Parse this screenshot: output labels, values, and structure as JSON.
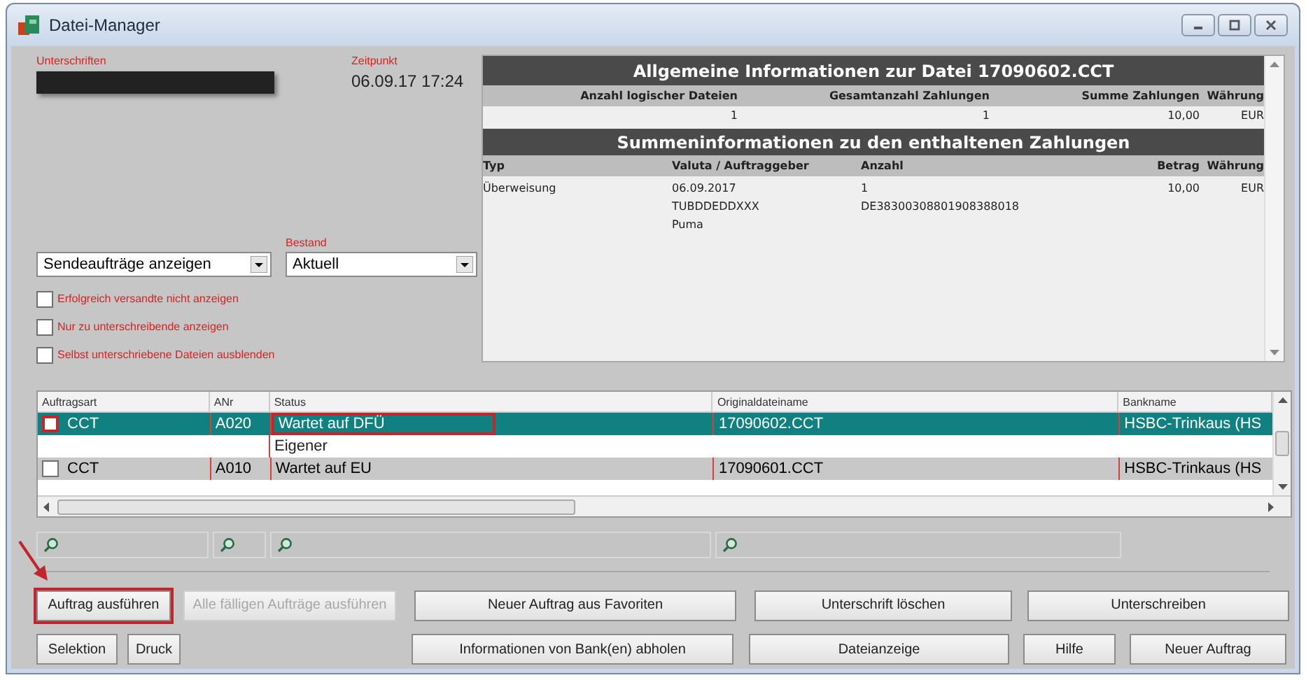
{
  "window": {
    "title": "Datei-Manager"
  },
  "signatures": {
    "label": "Unterschriften"
  },
  "timestamp": {
    "label": "Zeitpunkt",
    "value": "06.09.17 17:24"
  },
  "view_select": {
    "value": "Sendeaufträge anzeigen"
  },
  "stock_select": {
    "label": "Bestand",
    "value": "Aktuell"
  },
  "filters": [
    {
      "label": "Erfolgreich versandte nicht anzeigen",
      "checked": false
    },
    {
      "label": "Nur zu unterschreibende anzeigen",
      "checked": false
    },
    {
      "label": "Selbst unterschriebene Dateien ausblenden",
      "checked": false
    }
  ],
  "info": {
    "general_title": "Allgemeine Informationen zur Datei 17090602.CCT",
    "general_columns": [
      "Anzahl logischer Dateien",
      "Gesamtanzahl Zahlungen",
      "Summe Zahlungen",
      "Währung"
    ],
    "general_values": [
      "1",
      "1",
      "10,00",
      "EUR"
    ],
    "summary_title": "Summeninformationen zu den enthaltenen Zahlungen",
    "summary_columns": [
      "Typ",
      "Valuta / Auftraggeber",
      "Anzahl",
      "Betrag",
      "Währung"
    ],
    "summary_rows": [
      {
        "type": "Überweisung",
        "valuta": [
          "06.09.2017",
          "TUBDDEDDXXX",
          "Puma"
        ],
        "count": [
          "1",
          "DE38300308801908388018"
        ],
        "amount": "10,00",
        "currency": "EUR"
      }
    ]
  },
  "table": {
    "columns": [
      "Auftragsart",
      "ANr",
      "Status",
      "Originaldateiname",
      "Bankname"
    ],
    "rows": [
      {
        "checked": false,
        "selected": true,
        "highlighted": true,
        "cells": [
          "CCT",
          "A020",
          "Wartet auf DFÜ",
          "17090602.CCT",
          "HSBC-Trinkaus (HS"
        ],
        "note": "Eigener"
      },
      {
        "checked": false,
        "selected": false,
        "highlighted": false,
        "cells": [
          "CCT",
          "A010",
          "Wartet auf EU",
          "17090601.CCT",
          "HSBC-Trinkaus (HS"
        ]
      }
    ]
  },
  "button_rows": [
    [
      {
        "label": "Auftrag ausführen",
        "disabled": false,
        "highlighted": true
      },
      {
        "label": "Alle fälligen Aufträge ausführen",
        "disabled": true,
        "highlighted": false
      },
      {
        "label": "Neuer Auftrag aus Favoriten",
        "disabled": false,
        "highlighted": false
      },
      {
        "label": "Unterschrift löschen",
        "disabled": false,
        "highlighted": false
      },
      {
        "label": "Unterschreiben",
        "disabled": false,
        "highlighted": false
      }
    ],
    [
      {
        "label": "Selektion",
        "disabled": false,
        "highlighted": false
      },
      {
        "label": "Druck",
        "disabled": false,
        "highlighted": false
      },
      {
        "label": "Informationen von Bank(en) abholen",
        "disabled": false,
        "highlighted": false
      },
      {
        "label": "Dateianzeige",
        "disabled": false,
        "highlighted": false
      },
      {
        "label": "Hilfe",
        "disabled": false,
        "highlighted": false
      },
      {
        "label": "Neuer Auftrag",
        "disabled": false,
        "highlighted": false
      }
    ]
  ]
}
